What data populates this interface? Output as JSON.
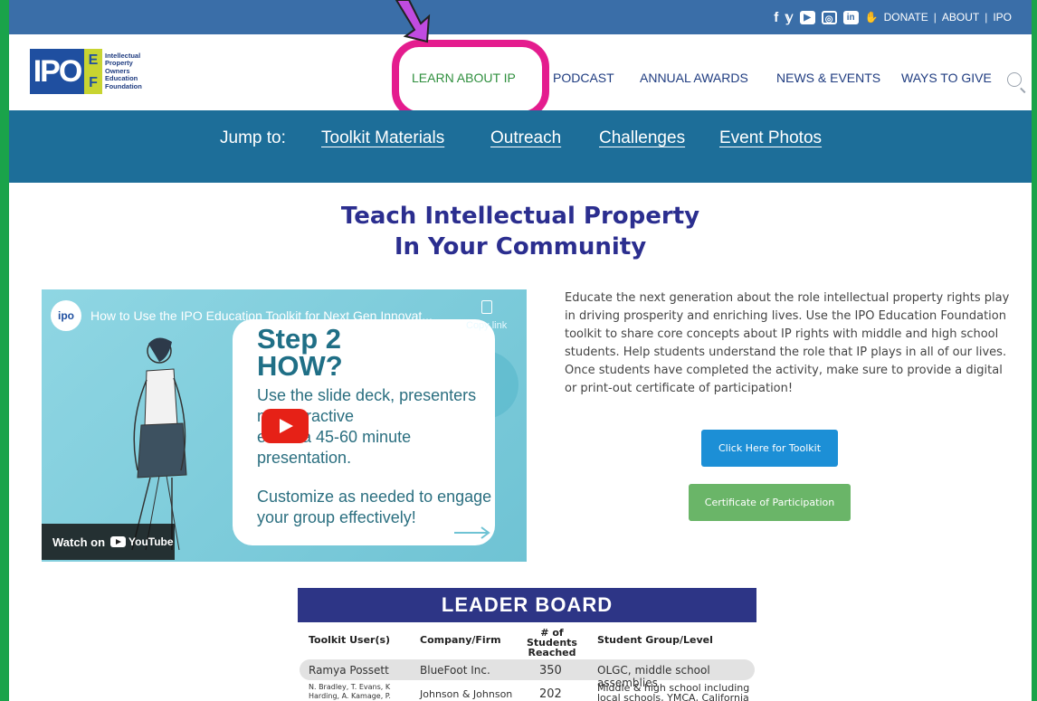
{
  "topbar": {
    "social": [
      "f",
      "y",
      "yt",
      "ig",
      "in"
    ],
    "donate_label": "DONATE",
    "about_label": "ABOUT",
    "ipo_label": "IPO",
    "separator": "|"
  },
  "logo": {
    "mark": "IPO",
    "ef": "EF",
    "text_lines": [
      "Intellectual",
      "Property",
      "Owners",
      "Education",
      "Foundation"
    ]
  },
  "nav": {
    "items": [
      {
        "label": "LEARN ABOUT IP",
        "active": true
      },
      {
        "label": "PODCAST"
      },
      {
        "label": "ANNUAL AWARDS"
      },
      {
        "label": "NEWS & EVENTS"
      },
      {
        "label": "WAYS TO GIVE"
      }
    ]
  },
  "jump": {
    "label": "Jump to:",
    "links": [
      "Toolkit Materials",
      "Outreach",
      "Challenges",
      "Event Photos"
    ]
  },
  "main": {
    "heading_line1": "Teach Intellectual Property",
    "heading_line2": "In Your Community",
    "intro": "Educate the next generation about the role intellectual property rights play in driving prosperity and enriching lives. Use the IPO Education Foundation toolkit to share core concepts about IP rights with middle and high school students. Help students understand the role that IP plays in all of our lives. Once students have completed the activity, make sure to provide a digital or print-out certificate of participation!",
    "toolkit_button": "Click Here for Toolkit",
    "certificate_button": "Certificate of Participation"
  },
  "video": {
    "avatar": "ipo",
    "title": "How to Use the IPO Education Toolkit for Next Gen Innovat...",
    "copy_label": "Copy link",
    "step_title_1": "Step 2",
    "step_title_2": "HOW?",
    "body_1": "Use the slide deck, presenters notes, and interactive activities for a 45-60 minute presentation.",
    "body_visible": "Use the slide deck, presenters\n      nd interactive\n      es for a 45-60 minute\npresentation.",
    "body_2": "Customize as needed to engage your group effectively!",
    "watch_on": "Watch on",
    "youtube": "YouTube"
  },
  "leaderboard": {
    "title": "LEADER BOARD",
    "columns": [
      "Toolkit User(s)",
      "Company/Firm",
      "# of Students Reached",
      "Student Group/Level"
    ],
    "rows": [
      [
        "Ramya Possett",
        "BlueFoot Inc.",
        "350",
        "OLGC, middle school assemblies"
      ],
      [
        "N. Bradley, T. Evans, K Harding, A. Kamage, P.",
        "Johnson & Johnson",
        "202",
        "Middle & high school including local schools, YMCA, California"
      ]
    ]
  }
}
